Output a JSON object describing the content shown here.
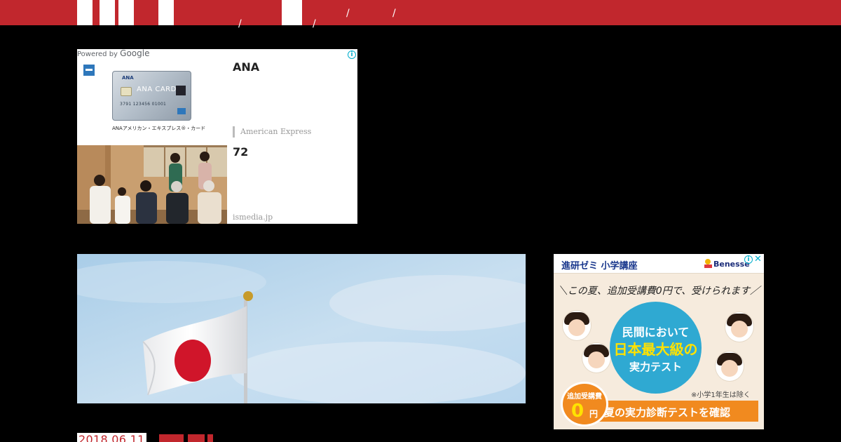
{
  "header": {
    "nav": [
      "/",
      "/",
      "/",
      "/"
    ],
    "nav_sub": [
      "",
      "",
      "",
      ""
    ]
  },
  "google_ad": {
    "powered_by": "Powered by",
    "google": "Google",
    "info_glyph": "i",
    "item1": {
      "card_brand": "ANA",
      "card_label": "ANA CARD",
      "card_number": "3791 123456 01001",
      "caption": "ANAアメリカン・エキスプレス®・カード",
      "title": "ANA",
      "sponsor": "American Express"
    },
    "item2": {
      "title": "72",
      "domain": "ismedia.jp"
    }
  },
  "benesse_ad": {
    "title": "進研ゼミ 小学講座",
    "brand": "Benesse",
    "info_glyph": "i",
    "close_glyph": "✕",
    "headline": "＼この夏、追加受講費0円で、受けられます／",
    "circle_line1": "民間において",
    "circle_line2": "日本最大級の",
    "circle_line3": "実力テスト",
    "note": "※小学1年生は除く",
    "badge_top": "追加受講費",
    "badge_big": "0",
    "badge_unit": "円",
    "cta": "夏の実力診断テストを確認"
  },
  "article": {
    "date": "2018.06.11",
    "tags": [
      "",
      ""
    ]
  }
}
